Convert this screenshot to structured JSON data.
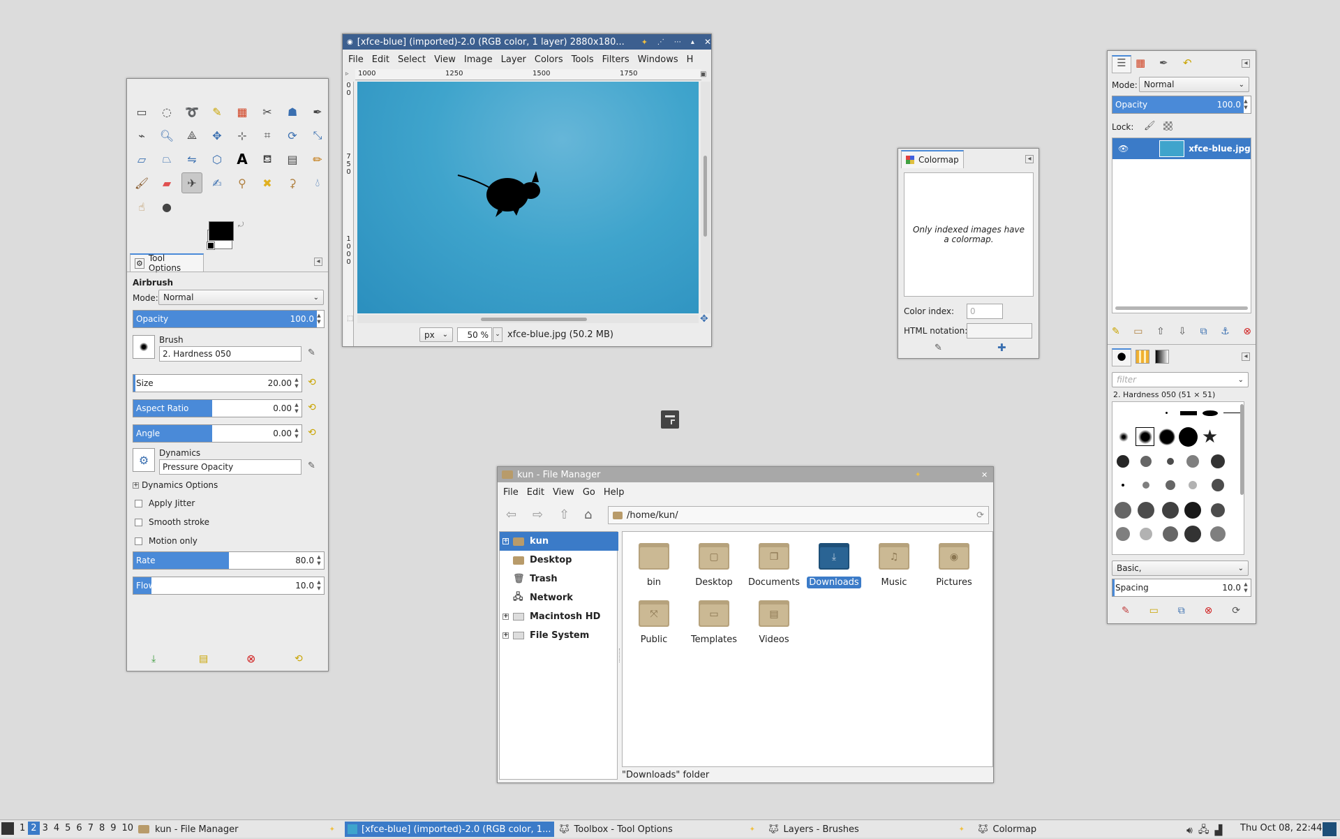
{
  "toolbox": {
    "tool_options_tab": "Tool Options",
    "tool_name": "Airbrush",
    "mode_label": "Mode:",
    "mode_value": "Normal",
    "opacity_label": "Opacity",
    "opacity_value": "100.0",
    "opacity_fraction": 1.0,
    "brush_label": "Brush",
    "brush_value": "2. Hardness 050",
    "size_label": "Size",
    "size_value": "20.00",
    "aspect_label": "Aspect Ratio",
    "aspect_value": "0.00",
    "angle_label": "Angle",
    "angle_value": "0.00",
    "dynamics_label": "Dynamics",
    "dynamics_value": "Pressure Opacity",
    "dynamics_options": "Dynamics Options",
    "apply_jitter": "Apply Jitter",
    "smooth_stroke": "Smooth stroke",
    "motion_only": "Motion only",
    "rate_label": "Rate",
    "rate_value": "80.0",
    "rate_fraction": 0.5,
    "flow_label": "Flow",
    "flow_value": "10.0",
    "flow_fraction": 0.1,
    "fg_color": "#000000",
    "bg_color": "#ffffff"
  },
  "image_window": {
    "title": "[xfce-blue] (imported)-2.0 (RGB color, 1 layer) 2880x180...",
    "menu": [
      "File",
      "Edit",
      "Select",
      "View",
      "Image",
      "Layer",
      "Colors",
      "Tools",
      "Filters",
      "Windows",
      "H"
    ],
    "ruler_marks": [
      "1000",
      "1250",
      "1500",
      "1750"
    ],
    "vruler_marks": [
      "0",
      "0",
      "7",
      "5",
      "0",
      "1",
      "0",
      "0",
      "0"
    ],
    "unit": "px",
    "zoom": "50 %",
    "status": "xfce-blue.jpg (50.2 MB)"
  },
  "colormap": {
    "tab": "Colormap",
    "message": "Only indexed images have a colormap.",
    "color_index_label": "Color index:",
    "color_index_value": "0",
    "html_notation_label": "HTML notation:",
    "html_notation_value": ""
  },
  "layers": {
    "mode_label": "Mode:",
    "mode_value": "Normal",
    "opacity_label": "Opacity",
    "opacity_value": "100.0",
    "lock_label": "Lock:",
    "layer_name": "xfce-blue.jpg",
    "filter_placeholder": "filter",
    "brush_name": "2. Hardness 050 (51 × 51)",
    "tag_value": "Basic,",
    "spacing_label": "Spacing",
    "spacing_value": "10.0"
  },
  "file_manager": {
    "title": "kun - File Manager",
    "menu": [
      "File",
      "Edit",
      "View",
      "Go",
      "Help"
    ],
    "path": "/home/kun/",
    "sidebar": [
      "kun",
      "Desktop",
      "Trash",
      "Network",
      "Macintosh HD",
      "File System"
    ],
    "folders": [
      "bin",
      "Desktop",
      "Documents",
      "Downloads",
      "Music",
      "Pictures",
      "Public",
      "Templates",
      "Videos"
    ],
    "status": "\"Downloads\" folder"
  },
  "taskbar": {
    "workspaces": [
      "1",
      "2",
      "3",
      "4",
      "5",
      "6",
      "7",
      "8",
      "9",
      "10"
    ],
    "active_workspace": "2",
    "tasks": [
      "kun - File Manager",
      "[xfce-blue] (imported)-2.0 (RGB color, 1...",
      "Toolbox - Tool Options",
      "Layers - Brushes",
      "Colormap"
    ],
    "clock": "Thu Oct 08, 22:44"
  },
  "colors": {
    "accent": "#4a8ad8",
    "selection": "#3b7bc8",
    "canvas": "#3fa4cc"
  }
}
